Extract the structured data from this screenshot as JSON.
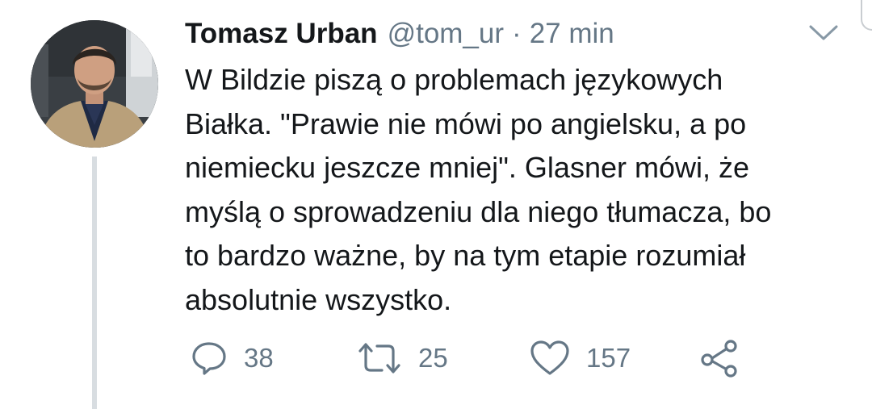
{
  "tweet": {
    "author_name": "Tomasz Urban",
    "handle": "@tom_ur",
    "separator": "·",
    "time": "27 min",
    "text_lines": [
      "W Bildzie piszą o problemach językowych",
      "Białka. \"Prawie nie mówi po angielsku, a po",
      "niemiecku jeszcze mniej\". Glasner mówi, że",
      "myślą o sprowadzeniu dla niego tłumacza, bo",
      "to bardzo ważne, by na tym etapie rozumiał",
      "absolutnie wszystko."
    ]
  },
  "actions": {
    "reply_count": "38",
    "retweet_count": "25",
    "like_count": "157"
  },
  "icons": {
    "reply": "reply-icon",
    "retweet": "retweet-icon",
    "like": "heart-icon",
    "share": "share-icon",
    "menu": "chevron-down-icon"
  },
  "colors": {
    "text": "#14171a",
    "muted": "#657786",
    "thread_line": "#d8dde1"
  }
}
